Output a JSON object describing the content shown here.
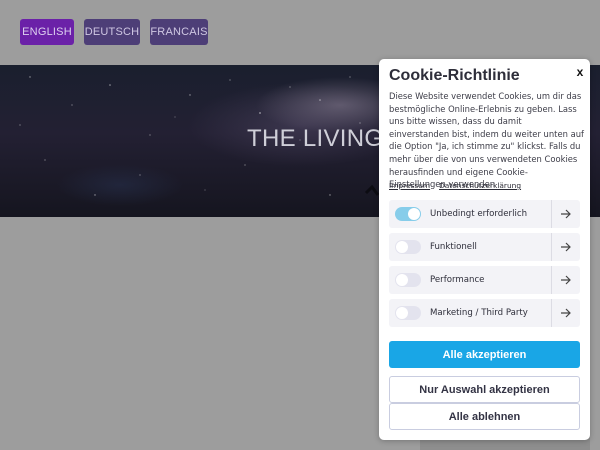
{
  "languages": [
    {
      "label": "ENGLISH",
      "active": true
    },
    {
      "label": "DEUTSCH",
      "active": false
    },
    {
      "label": "FRANCAIS",
      "active": false
    }
  ],
  "hero": {
    "title": "THE LIVING S"
  },
  "cookie": {
    "title": "Cookie-Richtlinie",
    "close_label": "x",
    "description": "Diese Website verwendet Cookies, um dir das bestmögliche Online-Erlebnis zu geben. Lass uns bitte wissen, dass du damit einverstanden bist, indem du weiter unten auf die Option \"Ja, ich stimme zu\" klickst. Falls du mehr über die von uns verwendeten Cookies herausfinden und eigene Cookie-Einstellungen verwenden",
    "links": {
      "imprint": "Impressum",
      "privacy": "Datenschutzerklärung"
    },
    "categories": [
      {
        "label": "Unbedingt erforderlich",
        "enabled": true
      },
      {
        "label": "Funktionell",
        "enabled": false
      },
      {
        "label": "Performance",
        "enabled": false
      },
      {
        "label": "Marketing / Third Party",
        "enabled": false
      }
    ],
    "buttons": {
      "accept_all": "Alle akzeptieren",
      "accept_selection": "Nur Auswahl akzeptieren",
      "reject_all": "Alle ablehnen"
    }
  },
  "colors": {
    "overlay": "#9d9d9d",
    "lang_active": "#6b21a8",
    "lang_inactive": "#4d3e77",
    "accept_button": "#19a6e6",
    "toggle_on": "#87cdea",
    "toggle_off": "#e3e3ee"
  },
  "icons": {
    "close": "close-icon",
    "category_arrow": "arrow-right-icon"
  }
}
